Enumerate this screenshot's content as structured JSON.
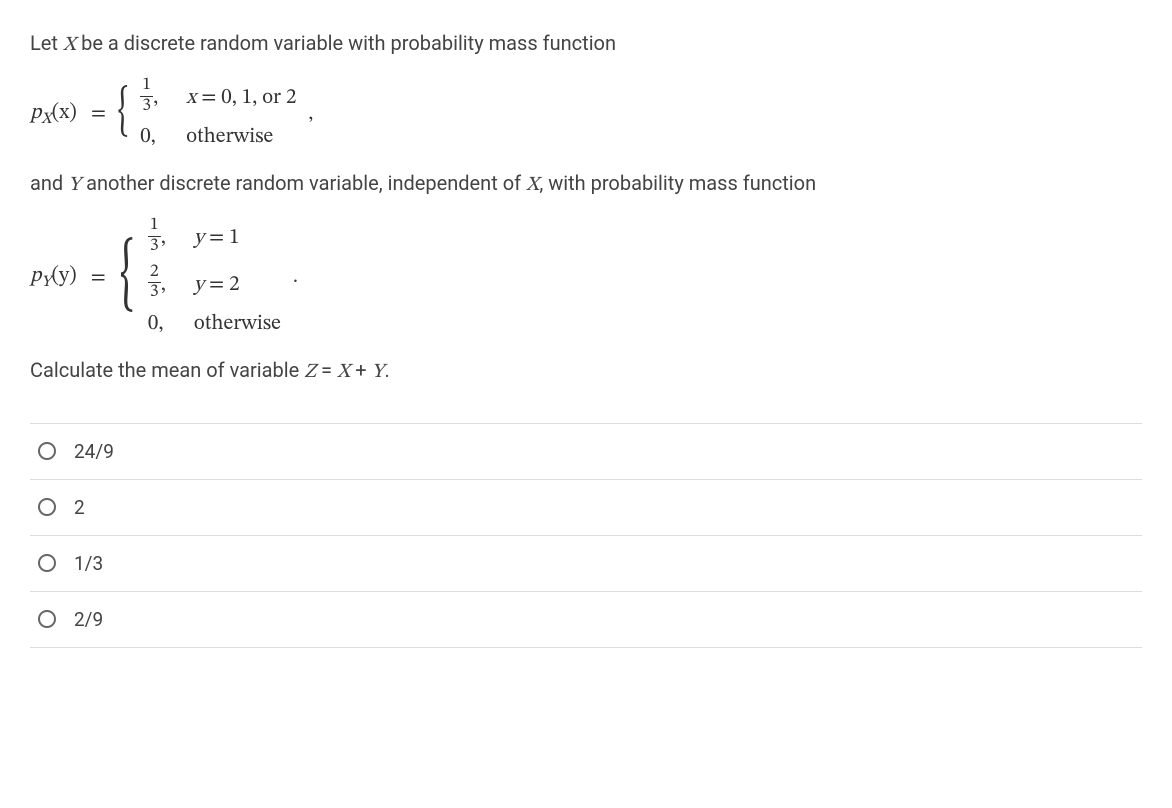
{
  "intro": "Let X be a discrete random variable with probability mass function",
  "pmfX": {
    "label_p": "p",
    "label_sub": "X",
    "label_arg": "(x)",
    "case1_val_num": "1",
    "case1_val_den": "3",
    "case1_comma": ",",
    "case1_cond": "x = 0, 1, or 2",
    "case2_val": "0,",
    "case2_cond": "otherwise",
    "trail": ","
  },
  "mid": "and Y another discrete random variable, independent of X, with probability mass function",
  "pmfY": {
    "label_p": "p",
    "label_sub": "Y",
    "label_arg": "(y)",
    "case1_val_num": "1",
    "case1_val_den": "3",
    "case1_comma": ",",
    "case1_cond": "y = 1",
    "case2_val_num": "2",
    "case2_val_den": "3",
    "case2_comma": ",",
    "case2_cond": "y = 2",
    "case3_val": "0,",
    "case3_cond": "otherwise",
    "trail": "."
  },
  "ask": "Calculate the mean of variable Z = X + Y.",
  "options": [
    {
      "label": "24/9"
    },
    {
      "label": "2"
    },
    {
      "label": "1/3"
    },
    {
      "label": "2/9"
    }
  ]
}
